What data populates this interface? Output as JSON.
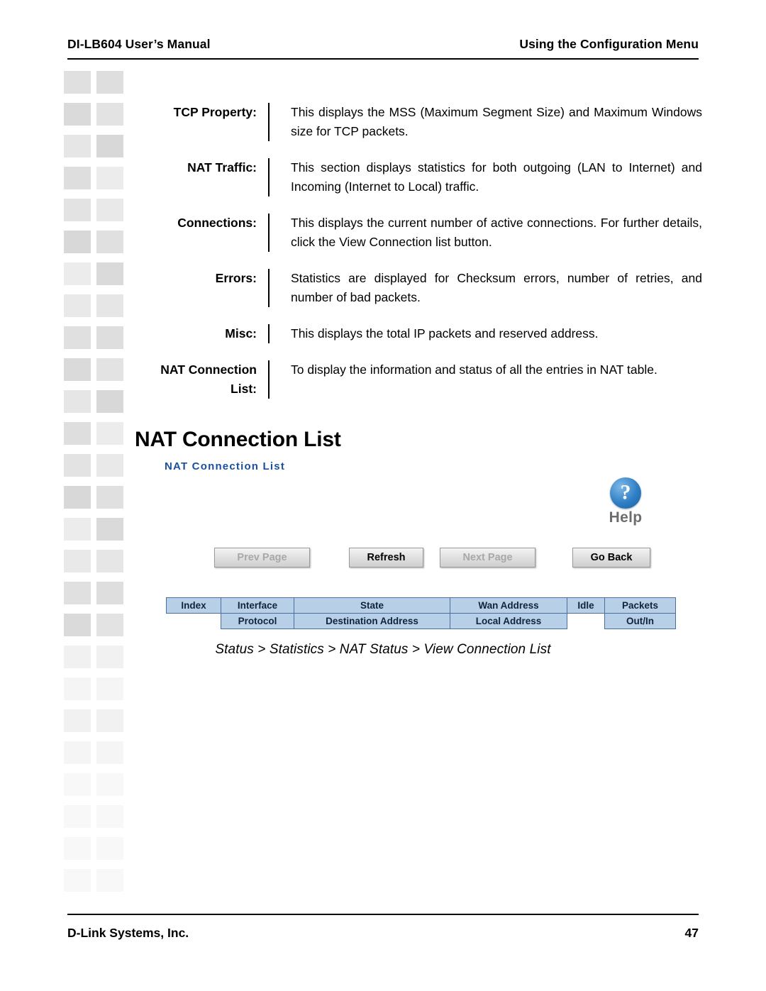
{
  "header": {
    "left": "DI-LB604 User’s Manual",
    "right": "Using the Configuration Menu"
  },
  "definitions": [
    {
      "term": "TCP Property:",
      "desc": "This displays the MSS (Maximum Segment Size) and Maximum Windows size for TCP packets."
    },
    {
      "term": "NAT Traffic:",
      "desc": "This section displays statistics for both outgoing (LAN to Internet) and Incoming (Internet to Local) traffic."
    },
    {
      "term": "Connections:",
      "desc": "This displays the current number of active connections. For further details, click the View Connection list button."
    },
    {
      "term": "Errors:",
      "desc": "Statistics are displayed for Checksum errors, number of retries, and number of bad packets."
    },
    {
      "term": "Misc:",
      "desc": "This displays the total IP packets and reserved address."
    },
    {
      "term": "NAT Connection List:",
      "desc": "To display the information and status of all the entries in NAT table."
    }
  ],
  "section": {
    "title": "NAT Connection List"
  },
  "ui": {
    "panel_title": "NAT Connection List",
    "help_label": "Help",
    "help_glyph": "?",
    "buttons": [
      {
        "label": "Prev Page",
        "state": "disabled"
      },
      {
        "label": "Refresh",
        "state": "active"
      },
      {
        "label": "Next Page",
        "state": "disabled"
      },
      {
        "label": "Go Back",
        "state": "active"
      }
    ],
    "table": {
      "row1": [
        "Index",
        "Interface",
        "State",
        "Wan Address",
        "Idle",
        "Packets"
      ],
      "row2": [
        "",
        "Protocol",
        "Destination Address",
        "Local Address",
        "",
        "Out/In"
      ]
    },
    "caption": "Status > Statistics > NAT Status > View Connection List"
  },
  "footer": {
    "left": "D-Link Systems, Inc.",
    "right": "47"
  },
  "colors": {
    "accent_blue": "#1a4f9c",
    "table_header": "#b8cfe8",
    "table_border": "#4a6f9e"
  }
}
